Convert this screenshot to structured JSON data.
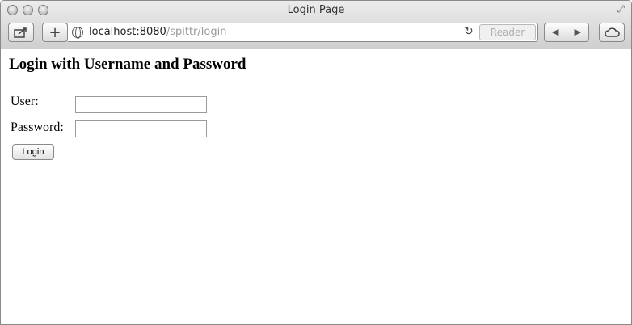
{
  "window": {
    "title": "Login Page",
    "address_host": "localhost:8080",
    "address_path": "/spittr/login",
    "reader_label": "Reader"
  },
  "icons": {
    "share": "share-icon",
    "new_tab": "plus-icon",
    "site": "globe-icon",
    "reload": "reload-icon",
    "back": "back-arrow-icon",
    "forward": "forward-arrow-icon",
    "cloud": "cloud-icon",
    "fullscreen": "fullscreen-icon"
  },
  "page": {
    "heading": "Login with Username and Password",
    "user_label": "User:",
    "user_value": "",
    "password_label": "Password:",
    "password_value": "",
    "login_button": "Login"
  }
}
